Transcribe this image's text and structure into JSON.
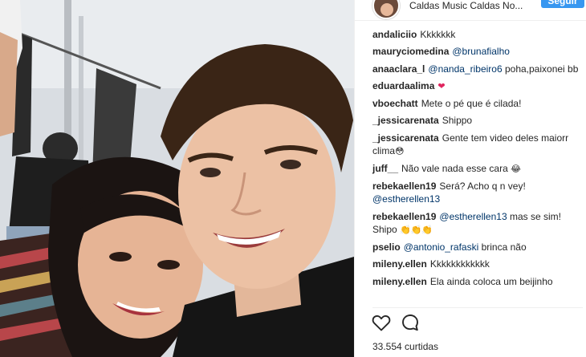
{
  "header": {
    "location": "Caldas Music Caldas No...",
    "follow_label": "Seguir"
  },
  "comments": [
    {
      "user": "andaliciio",
      "parts": [
        {
          "t": "text",
          "v": "Kkkkkkk"
        }
      ]
    },
    {
      "user": "mauryciomedina",
      "parts": [
        {
          "t": "mention",
          "v": "@brunafialho"
        }
      ]
    },
    {
      "user": "anaaclara_l",
      "parts": [
        {
          "t": "mention",
          "v": "@nanda_ribeiro6"
        },
        {
          "t": "text",
          "v": " poha,paixonei bb"
        }
      ]
    },
    {
      "user": "eduardaalima",
      "parts": [
        {
          "t": "heart",
          "v": "❤"
        }
      ]
    },
    {
      "user": "vboechatt",
      "parts": [
        {
          "t": "text",
          "v": "Mete o pé que é cilada!"
        }
      ]
    },
    {
      "user": "_jessicarenata",
      "parts": [
        {
          "t": "text",
          "v": "Shippo"
        }
      ]
    },
    {
      "user": "_jessicarenata",
      "parts": [
        {
          "t": "text",
          "v": "Gente tem video deles maiorr clima"
        },
        {
          "t": "emoji",
          "v": "😳"
        }
      ]
    },
    {
      "user": "juff__",
      "parts": [
        {
          "t": "text",
          "v": "Não vale nada esse cara "
        },
        {
          "t": "emoji",
          "v": "😂"
        }
      ]
    },
    {
      "user": "rebekaellen19",
      "parts": [
        {
          "t": "text",
          "v": "Será? Acho q n vey! "
        },
        {
          "t": "mention",
          "v": "@estherellen13"
        }
      ]
    },
    {
      "user": "rebekaellen19",
      "parts": [
        {
          "t": "mention",
          "v": "@estherellen13"
        },
        {
          "t": "text",
          "v": " mas se sim! Shipo "
        },
        {
          "t": "emoji",
          "v": "👏👏👏"
        }
      ]
    },
    {
      "user": "pselio",
      "parts": [
        {
          "t": "mention",
          "v": "@antonio_rafaski"
        },
        {
          "t": "text",
          "v": " brinca não"
        }
      ]
    },
    {
      "user": "mileny.ellen",
      "parts": [
        {
          "t": "text",
          "v": "Kkkkkkkkkkkk"
        }
      ]
    },
    {
      "user": "mileny.ellen",
      "parts": [
        {
          "t": "text",
          "v": "Ela ainda coloca um beijinho"
        }
      ]
    }
  ],
  "likes_text": "33.554 curtidas",
  "icons": {
    "like": "heart-outline-icon",
    "comment": "speech-bubble-icon"
  },
  "colors": {
    "follow_button": "#3897f0",
    "mention": "#003569",
    "heart": "#e0245e"
  }
}
